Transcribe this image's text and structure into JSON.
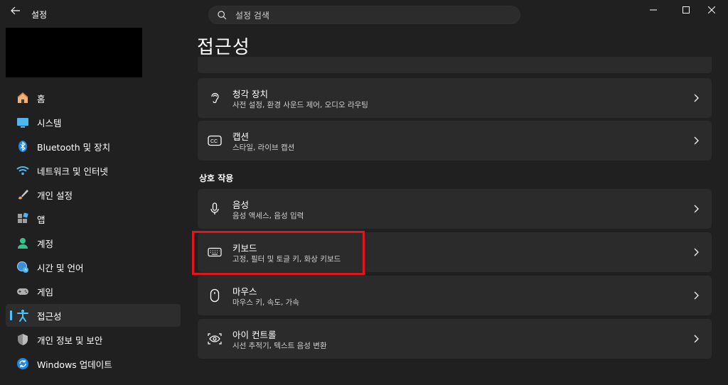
{
  "app": {
    "title": "설정",
    "back_icon": "back-arrow-icon"
  },
  "search": {
    "placeholder": "설정 검색",
    "icon": "search-icon"
  },
  "window_controls": [
    "minimize",
    "maximize",
    "close"
  ],
  "page": {
    "title": "접근성"
  },
  "sidebar": {
    "items": [
      {
        "label": "홈",
        "icon": "home-icon",
        "active": false
      },
      {
        "label": "시스템",
        "icon": "system-icon",
        "active": false
      },
      {
        "label": "Bluetooth 및 장치",
        "icon": "bluetooth-icon",
        "active": false
      },
      {
        "label": "네트워크 및 인터넷",
        "icon": "wifi-icon",
        "active": false
      },
      {
        "label": "개인 설정",
        "icon": "brush-icon",
        "active": false
      },
      {
        "label": "앱",
        "icon": "apps-icon",
        "active": false
      },
      {
        "label": "계정",
        "icon": "account-icon",
        "active": false
      },
      {
        "label": "시간 및 언어",
        "icon": "time-language-icon",
        "active": false
      },
      {
        "label": "게임",
        "icon": "gamepad-icon",
        "active": false
      },
      {
        "label": "접근성",
        "icon": "accessibility-icon",
        "active": true
      },
      {
        "label": "개인 정보 및 보안",
        "icon": "shield-icon",
        "active": false
      },
      {
        "label": "Windows 업데이트",
        "icon": "update-icon",
        "active": false
      }
    ]
  },
  "hearing": {
    "cards": [
      {
        "title": "청각 장치",
        "subtitle": "사전 설정, 환경 사운드 제어, 오디오 라우팅",
        "icon": "hearing-device-icon"
      },
      {
        "title": "캡션",
        "subtitle": "스타일, 라이브 캡션",
        "icon": "captions-icon"
      }
    ]
  },
  "interaction": {
    "section_label": "상호 작용",
    "cards": [
      {
        "title": "음성",
        "subtitle": "음성 액세스, 음성 입력",
        "icon": "microphone-icon"
      },
      {
        "title": "키보드",
        "subtitle": "고정, 필터 및 토글 키, 화상 키보드",
        "icon": "keyboard-icon",
        "highlighted": true
      },
      {
        "title": "마우스",
        "subtitle": "마우스 키, 속도, 가속",
        "icon": "mouse-icon"
      },
      {
        "title": "아이 컨트롤",
        "subtitle": "시선 추적기, 텍스트 음성 변환",
        "icon": "eye-control-icon"
      }
    ]
  },
  "colors": {
    "background": "#202020",
    "card": "#2b2b2b",
    "accent": "#4cc2ff",
    "highlight_border": "#e0161d"
  }
}
